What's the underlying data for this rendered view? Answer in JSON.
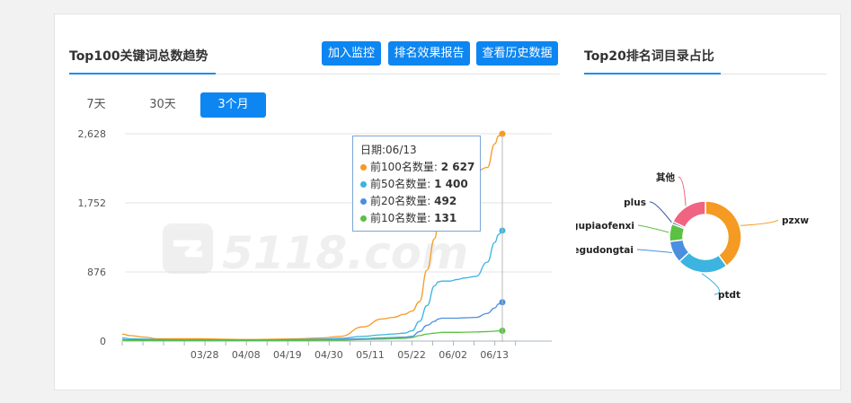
{
  "trend_panel": {
    "title": "Top100关键词总数趋势",
    "buttons": [
      "加入监控",
      "排名效果报告",
      "查看历史数据"
    ],
    "tabs": [
      "7天",
      "30天",
      "3个月"
    ],
    "active_tab": "3个月",
    "watermark": "5118.com",
    "tooltip": {
      "date_label": "日期:06/13",
      "rows": [
        {
          "label": "前100名数量:",
          "value": "2 627",
          "color": "#f59a23"
        },
        {
          "label": "前50名数量:",
          "value": "1 400",
          "color": "#3bb4e0"
        },
        {
          "label": "前20名数量:",
          "value": "492",
          "color": "#4a8fe0"
        },
        {
          "label": "前10名数量:",
          "value": "131",
          "color": "#5ac142"
        }
      ]
    }
  },
  "pie_panel": {
    "title": "Top20排名词目录占比"
  },
  "chart_data": [
    {
      "type": "line",
      "title": "Top100关键词总数趋势",
      "xlabel": "",
      "ylabel": "",
      "ylim": [
        0,
        2628
      ],
      "yticks": [
        0,
        876,
        1752,
        2628
      ],
      "ytick_labels": [
        "0",
        "876",
        "1,752",
        "2,628"
      ],
      "xtick_labels": [
        "03/28",
        "04/08",
        "04/19",
        "04/30",
        "05/11",
        "05/22",
        "06/02",
        "06/13"
      ],
      "x_day_offset": [
        -9,
        -7,
        -3,
        0,
        5,
        11,
        16,
        22,
        27,
        33,
        38,
        44,
        49,
        55,
        60,
        63,
        66,
        68,
        70,
        72,
        74,
        75,
        76,
        78,
        80,
        82,
        85,
        88,
        90,
        91,
        92
      ],
      "x_day_offset_note": "",
      "grid": true,
      "series": [
        {
          "color": "#f59a23",
          "values": [
            90,
            70,
            50,
            30,
            30,
            30,
            25,
            20,
            20,
            25,
            30,
            40,
            60,
            180,
            280,
            300,
            340,
            380,
            500,
            900,
            1300,
            1500,
            1700,
            2000,
            2150,
            2150,
            2150,
            2200,
            2500,
            2600,
            2627
          ]
        },
        {
          "color": "#3bb4e0",
          "values": [
            40,
            30,
            25,
            20,
            15,
            15,
            15,
            15,
            15,
            15,
            20,
            25,
            35,
            60,
            80,
            90,
            100,
            130,
            250,
            450,
            700,
            750,
            760,
            760,
            780,
            800,
            820,
            1000,
            1250,
            1350,
            1400
          ]
        },
        {
          "color": "#4a8fe0",
          "values": [
            20,
            15,
            15,
            12,
            10,
            10,
            10,
            10,
            10,
            10,
            12,
            15,
            20,
            30,
            40,
            45,
            50,
            60,
            120,
            200,
            250,
            280,
            290,
            290,
            290,
            295,
            300,
            350,
            420,
            470,
            492
          ]
        },
        {
          "color": "#5ac142",
          "values": [
            10,
            8,
            8,
            6,
            6,
            6,
            6,
            6,
            6,
            6,
            8,
            10,
            12,
            20,
            25,
            30,
            35,
            45,
            70,
            90,
            100,
            105,
            110,
            110,
            110,
            112,
            115,
            120,
            125,
            130,
            131
          ]
        }
      ]
    },
    {
      "type": "pie",
      "title": "Top20排名词目录占比",
      "slices": [
        {
          "label": "pzxw",
          "value": 40,
          "color": "#f59a23"
        },
        {
          "label": "ptdt",
          "value": 23,
          "color": "#3bb4e0"
        },
        {
          "label": "gegudongtai",
          "value": 10,
          "color": "#4a8fe0"
        },
        {
          "label": "gupiaofenxi",
          "value": 8,
          "color": "#5ac142"
        },
        {
          "label": "plus",
          "value": 1,
          "color": "#2f4f9e"
        },
        {
          "label": "其他",
          "value": 18,
          "color": "#f06482"
        }
      ]
    }
  ]
}
